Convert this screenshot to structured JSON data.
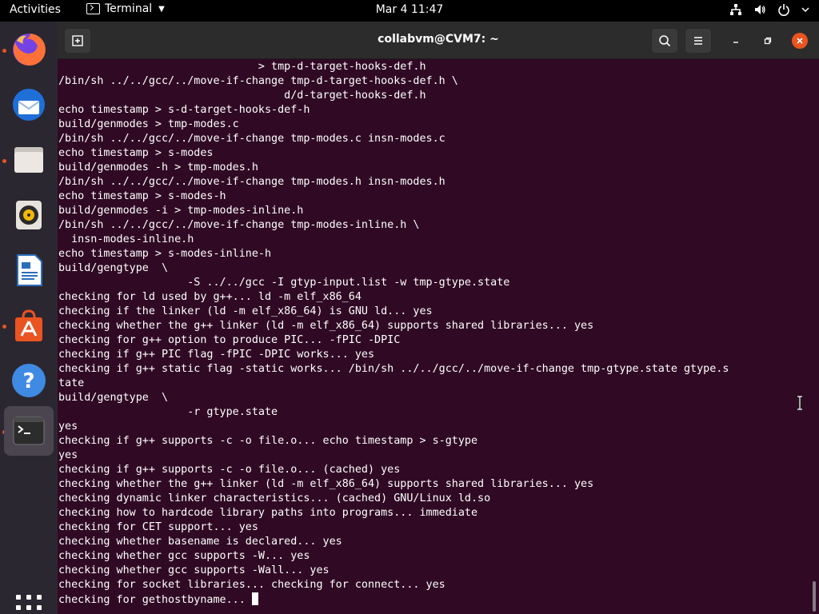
{
  "topbar": {
    "activities": "Activities",
    "app_name": "Terminal",
    "clock": "Mar 4  11:47"
  },
  "dock": {
    "items": [
      {
        "name": "firefox",
        "running": true
      },
      {
        "name": "thunderbird",
        "running": false
      },
      {
        "name": "files",
        "running": true
      },
      {
        "name": "rhythmbox",
        "running": false
      },
      {
        "name": "libreoffice-writer",
        "running": false
      },
      {
        "name": "ubuntu-software",
        "running": true
      },
      {
        "name": "help",
        "running": false
      },
      {
        "name": "terminal",
        "running": true
      }
    ]
  },
  "window": {
    "title": "collabvm@CVM7: ~"
  },
  "terminal": {
    "lines": [
      "                               > tmp-d-target-hooks-def.h",
      "/bin/sh ../../gcc/../move-if-change tmp-d-target-hooks-def.h \\",
      "                                   d/d-target-hooks-def.h",
      "echo timestamp > s-d-target-hooks-def-h",
      "build/genmodes > tmp-modes.c",
      "/bin/sh ../../gcc/../move-if-change tmp-modes.c insn-modes.c",
      "echo timestamp > s-modes",
      "build/genmodes -h > tmp-modes.h",
      "/bin/sh ../../gcc/../move-if-change tmp-modes.h insn-modes.h",
      "echo timestamp > s-modes-h",
      "build/genmodes -i > tmp-modes-inline.h",
      "/bin/sh ../../gcc/../move-if-change tmp-modes-inline.h \\",
      "  insn-modes-inline.h",
      "echo timestamp > s-modes-inline-h",
      "build/gengtype  \\",
      "                    -S ../../gcc -I gtyp-input.list -w tmp-gtype.state",
      "checking for ld used by g++... ld -m elf_x86_64",
      "checking if the linker (ld -m elf_x86_64) is GNU ld... yes",
      "checking whether the g++ linker (ld -m elf_x86_64) supports shared libraries... yes",
      "checking for g++ option to produce PIC... -fPIC -DPIC",
      "checking if g++ PIC flag -fPIC -DPIC works... yes",
      "checking if g++ static flag -static works... /bin/sh ../../gcc/../move-if-change tmp-gtype.state gtype.s",
      "tate",
      "build/gengtype  \\",
      "                    -r gtype.state",
      "yes",
      "checking if g++ supports -c -o file.o... echo timestamp > s-gtype",
      "yes",
      "checking if g++ supports -c -o file.o... (cached) yes",
      "checking whether the g++ linker (ld -m elf_x86_64) supports shared libraries... yes",
      "checking dynamic linker characteristics... (cached) GNU/Linux ld.so",
      "checking how to hardcode library paths into programs... immediate",
      "checking for CET support... yes",
      "checking whether basename is declared... yes",
      "checking whether gcc supports -W... yes",
      "checking whether gcc supports -Wall... yes",
      "checking for socket libraries... checking for connect... yes"
    ],
    "prompt_line": "checking for gethostbyname... "
  }
}
